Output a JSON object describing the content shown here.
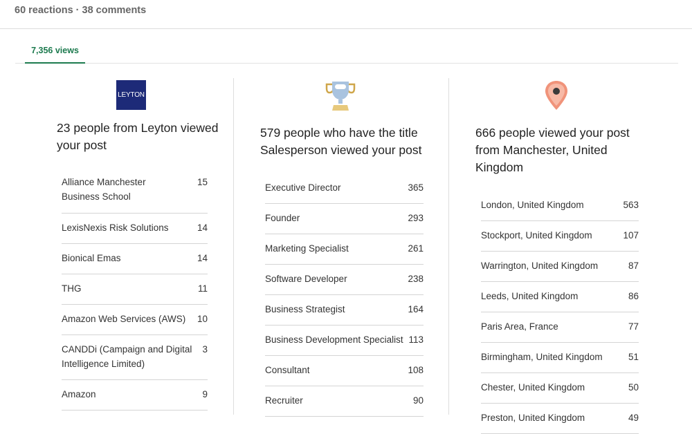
{
  "post": {
    "social_counts": "60 reactions · 38 comments"
  },
  "tabs": [
    {
      "label": "7,356 views",
      "active": true
    }
  ],
  "columns": [
    {
      "icon": "company-logo-leyton",
      "logo_text": "LEYTON",
      "heading": "23 people from Leyton viewed your post",
      "rows": [
        {
          "name": "Alliance Manchester Business School",
          "count": "15"
        },
        {
          "name": "LexisNexis Risk Solutions",
          "count": "14"
        },
        {
          "name": "Bionical Emas",
          "count": "14"
        },
        {
          "name": "THG",
          "count": "11"
        },
        {
          "name": "Amazon Web Services (AWS)",
          "count": "10"
        },
        {
          "name": "CANDDi (Campaign and Digital Intelligence Limited)",
          "count": "3"
        },
        {
          "name": "Amazon",
          "count": "9"
        }
      ]
    },
    {
      "icon": "trophy-icon",
      "heading": "579 people who have the title Salesperson viewed your post",
      "rows": [
        {
          "name": "Executive Director",
          "count": "365"
        },
        {
          "name": "Founder",
          "count": "293"
        },
        {
          "name": "Marketing Specialist",
          "count": "261"
        },
        {
          "name": "Software Developer",
          "count": "238"
        },
        {
          "name": "Business Strategist",
          "count": "164"
        },
        {
          "name": "Business Development Specialist",
          "count": "113"
        },
        {
          "name": "Consultant",
          "count": "108"
        },
        {
          "name": "Recruiter",
          "count": "90"
        }
      ]
    },
    {
      "icon": "location-pin-icon",
      "heading": "666 people viewed your post from Manchester, United Kingdom",
      "rows": [
        {
          "name": "London, United Kingdom",
          "count": "563"
        },
        {
          "name": "Stockport, United Kingdom",
          "count": "107"
        },
        {
          "name": "Warrington, United Kingdom",
          "count": "87"
        },
        {
          "name": "Leeds, United Kingdom",
          "count": "86"
        },
        {
          "name": "Paris Area, France",
          "count": "77"
        },
        {
          "name": "Birmingham, United Kingdom",
          "count": "51"
        },
        {
          "name": "Chester, United Kingdom",
          "count": "50"
        },
        {
          "name": "Preston, United Kingdom",
          "count": "49"
        }
      ]
    }
  ],
  "colors": {
    "accent": "#1c7a4e",
    "leyton_brand": "#1d2a78",
    "pin": "#f0937a",
    "trophy": "#a9c3df"
  }
}
